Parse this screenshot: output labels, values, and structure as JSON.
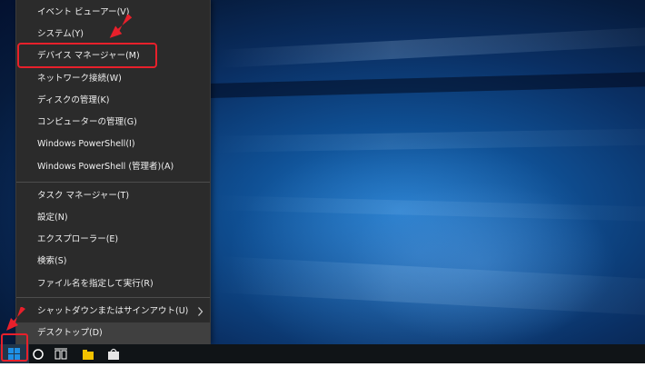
{
  "menu": {
    "items": [
      {
        "label": "イベント ビューアー(V)"
      },
      {
        "label": "システム(Y)"
      },
      {
        "label": "デバイス マネージャー(M)"
      },
      {
        "label": "ネットワーク接続(W)"
      },
      {
        "label": "ディスクの管理(K)"
      },
      {
        "label": "コンピューターの管理(G)"
      },
      {
        "label": "Windows PowerShell(I)"
      },
      {
        "label": "Windows PowerShell (管理者)(A)"
      },
      {
        "label": "タスク マネージャー(T)"
      },
      {
        "label": "設定(N)"
      },
      {
        "label": "エクスプローラー(E)"
      },
      {
        "label": "検索(S)"
      },
      {
        "label": "ファイル名を指定して実行(R)"
      },
      {
        "label": "シャットダウンまたはサインアウト(U)",
        "submenu_icon": "chevron-right-icon"
      },
      {
        "label": "デスクトップ(D)"
      }
    ],
    "highlighted_item": "デバイス マネージャー(M)",
    "hovered_item": "デスクトップ(D)"
  },
  "annotations": {
    "color": "#e8202b",
    "arrow_icon": "red-pointer-arrow-icon",
    "box_targets": [
      "device-manager-item",
      "start-button"
    ]
  },
  "taskbar": {
    "icons": [
      "windows-start-icon",
      "cortana-circle-icon",
      "task-view-icon",
      "file-explorer-icon",
      "store-icon"
    ]
  },
  "colors": {
    "menu_bg": "#2b2b2b",
    "menu_hover": "#404040",
    "taskbar_bg": "#101417",
    "start_blue": "#1e90e6"
  }
}
